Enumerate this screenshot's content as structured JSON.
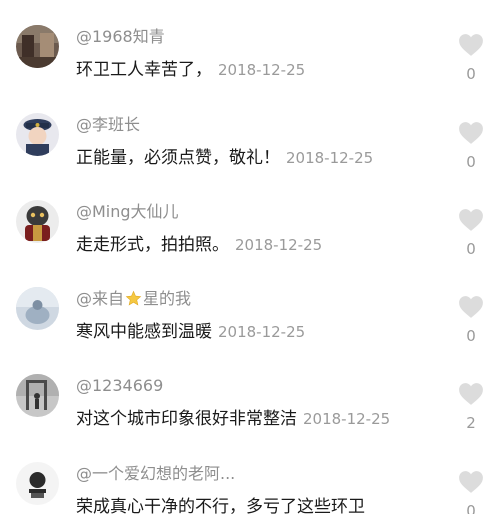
{
  "comments": [
    {
      "username": "@1968知青",
      "content": "环卫工人幸苦了，",
      "date": "2018-12-25",
      "likes": "0"
    },
    {
      "username": "@李班长",
      "content": "正能量，必须点赞，敬礼！",
      "date": "2018-12-25",
      "likes": "0"
    },
    {
      "username": "@Ming大仙儿",
      "content": "走走形式，拍拍照。",
      "date": "2018-12-25",
      "likes": "0"
    },
    {
      "username_pre": "@来自",
      "username_post": "星的我",
      "username_emoji": "star-emoji",
      "content": "寒风中能感到温暖",
      "date": "2018-12-25",
      "likes": "0"
    },
    {
      "username": "@1234669",
      "content": "对这个城市印象很好非常整洁",
      "date": "2018-12-25",
      "likes": "2"
    },
    {
      "username": "@一个爱幻想的老阿...",
      "content": "荣成真心干净的不行，多亏了这些环卫",
      "date": "",
      "likes": "0"
    }
  ],
  "colors": {
    "username": "#8e8e8e",
    "content": "#1a1a1a",
    "meta": "#9a9a9a",
    "heart": "#dcdcdc"
  },
  "icons": {
    "like": "heart-icon"
  }
}
